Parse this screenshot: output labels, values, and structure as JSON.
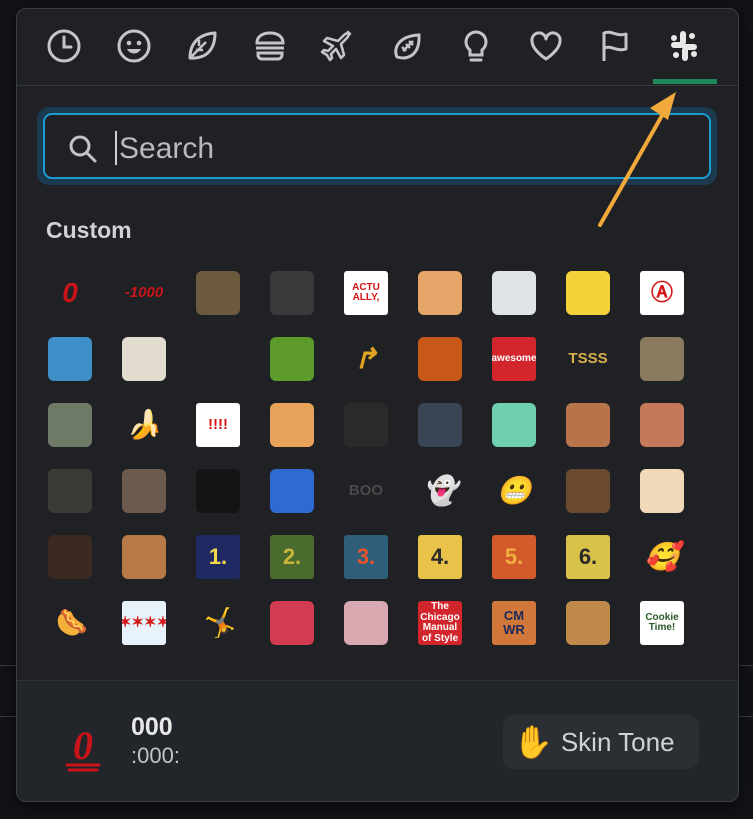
{
  "tabs": [
    {
      "name": "recent",
      "icon": "clock-icon"
    },
    {
      "name": "smileys",
      "icon": "smiley-icon"
    },
    {
      "name": "nature",
      "icon": "leaf-icon"
    },
    {
      "name": "food",
      "icon": "burger-icon"
    },
    {
      "name": "travel",
      "icon": "airplane-icon"
    },
    {
      "name": "activities",
      "icon": "football-icon"
    },
    {
      "name": "objects",
      "icon": "lightbulb-icon"
    },
    {
      "name": "symbols",
      "icon": "heart-icon"
    },
    {
      "name": "flags",
      "icon": "flag-icon"
    },
    {
      "name": "custom",
      "icon": "slack-icon",
      "active": true
    }
  ],
  "search": {
    "placeholder": "Search"
  },
  "section": {
    "title": "Custom"
  },
  "emoji_rows": [
    [
      {
        "name": "000",
        "style": "text",
        "text": "0",
        "color": "#c9141a",
        "bg": "transparent"
      },
      {
        "name": "-1000",
        "style": "text",
        "text": "-1000",
        "color": "#c9141a",
        "bg": "transparent"
      },
      {
        "name": "boars",
        "style": "swatch",
        "color": "#6b5a3e"
      },
      {
        "name": "walking",
        "style": "swatch",
        "color": "#3a3a3a"
      },
      {
        "name": "actually",
        "style": "label",
        "text": "ACTU ALLY,",
        "color": "#d41414",
        "bg": "#ffffff"
      },
      {
        "name": "ahsoka",
        "style": "swatch",
        "color": "#e6a66a"
      },
      {
        "name": "can",
        "style": "swatch",
        "color": "#dfe3e6"
      },
      {
        "name": "horn",
        "style": "swatch",
        "color": "#f4d23a"
      },
      {
        "name": "anarchy",
        "style": "label",
        "text": "Ⓐ",
        "color": "#d41414",
        "bg": "#ffffff"
      }
    ],
    [
      {
        "name": "villager",
        "style": "swatch",
        "color": "#3e8fc8"
      },
      {
        "name": "appa",
        "style": "swatch",
        "color": "#e2ddcf"
      },
      {
        "name": "apple",
        "style": "label",
        "text": "",
        "color": "#111111",
        "bg": "transparent"
      },
      {
        "name": "green-apple",
        "style": "swatch",
        "color": "#5c9a2a"
      },
      {
        "name": "arrow-shoot",
        "style": "text",
        "text": "↱",
        "color": "#e0a420",
        "bg": "transparent"
      },
      {
        "name": "phone-lady",
        "style": "swatch",
        "color": "#c7581a"
      },
      {
        "name": "awesome",
        "style": "label",
        "text": "awesome",
        "color": "#ffffff",
        "bg": "#d2262c"
      },
      {
        "name": "tsss",
        "style": "label",
        "text": "TSSS",
        "color": "#d9b04a",
        "bg": "transparent"
      },
      {
        "name": "baby-yoda",
        "style": "swatch",
        "color": "#8a7a5e"
      }
    ],
    [
      {
        "name": "grogu",
        "style": "swatch",
        "color": "#6e7a66"
      },
      {
        "name": "banana-dance",
        "style": "text",
        "text": "🍌",
        "color": "#f3d43a",
        "bg": "transparent"
      },
      {
        "name": "bang",
        "style": "label",
        "text": "!!!!",
        "color": "#d41414",
        "bg": "#ffffff"
      },
      {
        "name": "bb8",
        "style": "swatch",
        "color": "#e9a25a"
      },
      {
        "name": "kylo",
        "style": "swatch",
        "color": "#2a2a2a"
      },
      {
        "name": "kylo-2",
        "style": "swatch",
        "color": "#3a4656"
      },
      {
        "name": "crystal",
        "style": "swatch",
        "color": "#6fd0b0"
      },
      {
        "name": "face-1",
        "style": "swatch",
        "color": "#b7744a"
      },
      {
        "name": "face-2",
        "style": "swatch",
        "color": "#c6795a"
      }
    ],
    [
      {
        "name": "person",
        "style": "swatch",
        "color": "#3b3a34"
      },
      {
        "name": "dog",
        "style": "swatch",
        "color": "#6c5a4e"
      },
      {
        "name": "blackbox",
        "style": "swatch",
        "color": "#141414"
      },
      {
        "name": "blue-shell",
        "style": "swatch",
        "color": "#2f6ad0"
      },
      {
        "name": "boo",
        "style": "label",
        "text": "BOO",
        "color": "#4a4a4a",
        "bg": "transparent"
      },
      {
        "name": "ghost",
        "style": "text",
        "text": "👻",
        "color": "#444444",
        "bg": "transparent"
      },
      {
        "name": "grimace",
        "style": "text",
        "text": "😬",
        "color": "#f0c23a",
        "bg": "transparent"
      },
      {
        "name": "chair",
        "style": "swatch",
        "color": "#6a4a2e"
      },
      {
        "name": "caillou",
        "style": "swatch",
        "color": "#f0d8b8"
      }
    ],
    [
      {
        "name": "dark-photo",
        "style": "swatch",
        "color": "#3a2a22"
      },
      {
        "name": "box",
        "style": "swatch",
        "color": "#b77a46"
      },
      {
        "name": "one",
        "style": "label",
        "text": "1.",
        "color": "#f3d94a",
        "bg": "#1f2a63"
      },
      {
        "name": "two",
        "style": "label",
        "text": "2.",
        "color": "#c9b63a",
        "bg": "#4a6a2e"
      },
      {
        "name": "three",
        "style": "label",
        "text": "3.",
        "color": "#e8542c",
        "bg": "#2e5e7a"
      },
      {
        "name": "four",
        "style": "label",
        "text": "4.",
        "color": "#2a2a2a",
        "bg": "#e9c24a"
      },
      {
        "name": "five",
        "style": "label",
        "text": "5.",
        "color": "#f0b040",
        "bg": "#d35a2a"
      },
      {
        "name": "six",
        "style": "label",
        "text": "6.",
        "color": "#2a2a2a",
        "bg": "#d9c24a"
      },
      {
        "name": "chef",
        "style": "text",
        "text": "🥰",
        "color": "#f0c23a",
        "bg": "transparent"
      }
    ],
    [
      {
        "name": "hotdog",
        "style": "text",
        "text": "🌭",
        "color": "#c05a2a",
        "bg": "transparent"
      },
      {
        "name": "chicago",
        "style": "label",
        "text": "✶✶✶✶",
        "color": "#d41414",
        "bg": "#e8f2fb"
      },
      {
        "name": "chuck",
        "style": "text",
        "text": "🤸",
        "color": "#e08a20",
        "bg": "transparent"
      },
      {
        "name": "clogs",
        "style": "swatch",
        "color": "#d23b50"
      },
      {
        "name": "woman-drinking",
        "style": "swatch",
        "color": "#d9a9b2"
      },
      {
        "name": "chicago-manual",
        "style": "label",
        "text": "The Chicago Manual of Style",
        "color": "#ffffff",
        "bg": "#d2262c"
      },
      {
        "name": "cmwr",
        "style": "label",
        "text": "CM WR",
        "color": "#1b2a5a",
        "bg": "#d2773a"
      },
      {
        "name": "iced-coffee",
        "style": "swatch",
        "color": "#c08a4a"
      },
      {
        "name": "cookie-time",
        "style": "label",
        "text": "Cookie Time!",
        "color": "#2a5a2a",
        "bg": "#ffffff"
      }
    ],
    [
      {
        "name": "partial-1",
        "style": "swatch",
        "color": "#a03a2a"
      },
      {
        "name": "partial-2",
        "style": "swatch",
        "color": "#e8b83a"
      },
      {
        "name": "partial-3",
        "style": "swatch",
        "color": "#c58a7a"
      },
      {
        "name": "partial-4",
        "style": "swatch",
        "color": "#7a2a2a"
      },
      {
        "name": "partial-5",
        "style": "swatch",
        "color": "#c9a43a"
      },
      {
        "name": "partial-6",
        "style": "swatch",
        "color": "#d23a2a"
      },
      {
        "name": "partial-7",
        "style": "swatch",
        "color": "#f0c83a"
      },
      {
        "name": "partial-8",
        "style": "swatch",
        "color": "#3a8ad0"
      },
      {
        "name": "partial-9",
        "style": "swatch",
        "color": "#e07a8a"
      }
    ]
  ],
  "footer": {
    "preview_text": "0",
    "preview_name": "000",
    "preview_code": ":000:",
    "skin_tone_label": "Skin Tone",
    "skin_tone_icon": "raised-hand-icon"
  },
  "colors": {
    "accent_blue": "#1d9bd1",
    "active_tab": "#1e8a5c",
    "annotation_arrow": "#f2a93b"
  }
}
